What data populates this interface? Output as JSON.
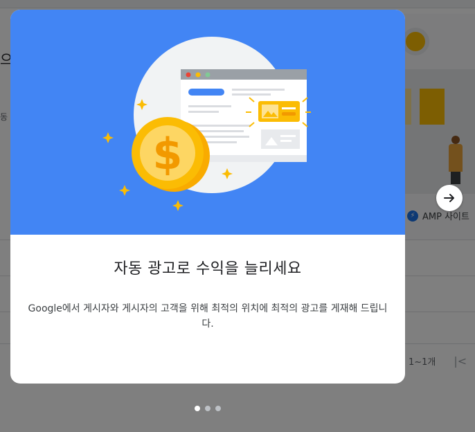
{
  "background": {
    "left_title": "으",
    "left_sub": "동",
    "amp_label": "AMP 사이트",
    "pagination_text": "1~1개"
  },
  "dialog": {
    "title": "자동 광고로 수익을 늘리세요",
    "body": "Google에서 게시자와 게시자의 고객을 위해 최적의 위치에 최적의 광고를 게재해 드립니다.",
    "hero_color": "#4285f4"
  },
  "carousel": {
    "page_count": 3,
    "active_index": 0
  },
  "icons": {
    "next": "arrow-right-icon",
    "first_page": "first-page-icon",
    "amp": "amp-bolt-icon",
    "dollar": "dollar-coin-icon"
  }
}
